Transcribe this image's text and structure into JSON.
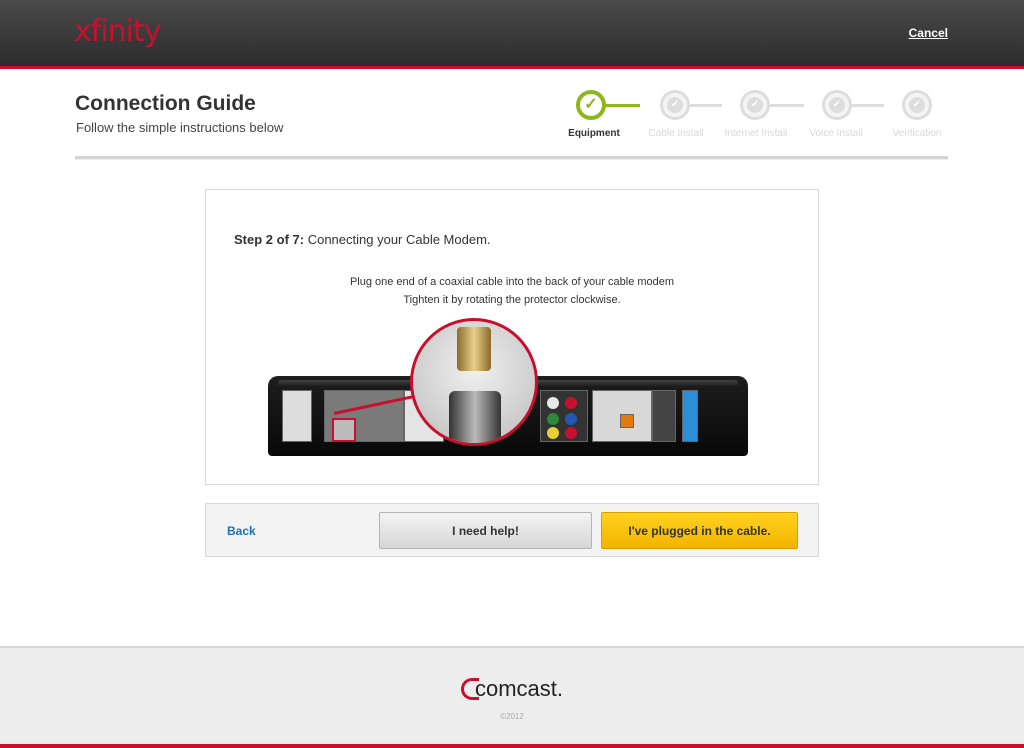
{
  "header": {
    "logo_text": "xfinity",
    "cancel_label": "Cancel"
  },
  "page": {
    "title": "Connection Guide",
    "subtitle": "Follow the simple instructions below"
  },
  "progress": {
    "steps": [
      {
        "label": "Equipment",
        "state": "active"
      },
      {
        "label": "Cable Install",
        "state": "pending"
      },
      {
        "label": "Internet Install",
        "state": "pending"
      },
      {
        "label": "Voice Install",
        "state": "pending"
      },
      {
        "label": "Verification",
        "state": "pending"
      }
    ],
    "check_glyph": "✓"
  },
  "card": {
    "step_prefix": "Step 2 of 7:",
    "step_title": "Connecting your Cable Modem.",
    "instruction_line1": "Plug one end of a coaxial cable into the back of your cable modem",
    "instruction_line2": "Tighten it by rotating the protector clockwise."
  },
  "actions": {
    "back_label": "Back",
    "help_label": "I need help!",
    "primary_label": "I've plugged in the cable."
  },
  "footer": {
    "brand": "comcast",
    "brand_suffix": ".",
    "copyright": "©2012"
  },
  "colors": {
    "brand_red": "#c8102e",
    "progress_green": "#8cb81c",
    "primary_yellow": "#ffd21f",
    "link_blue": "#1a6fbf"
  }
}
